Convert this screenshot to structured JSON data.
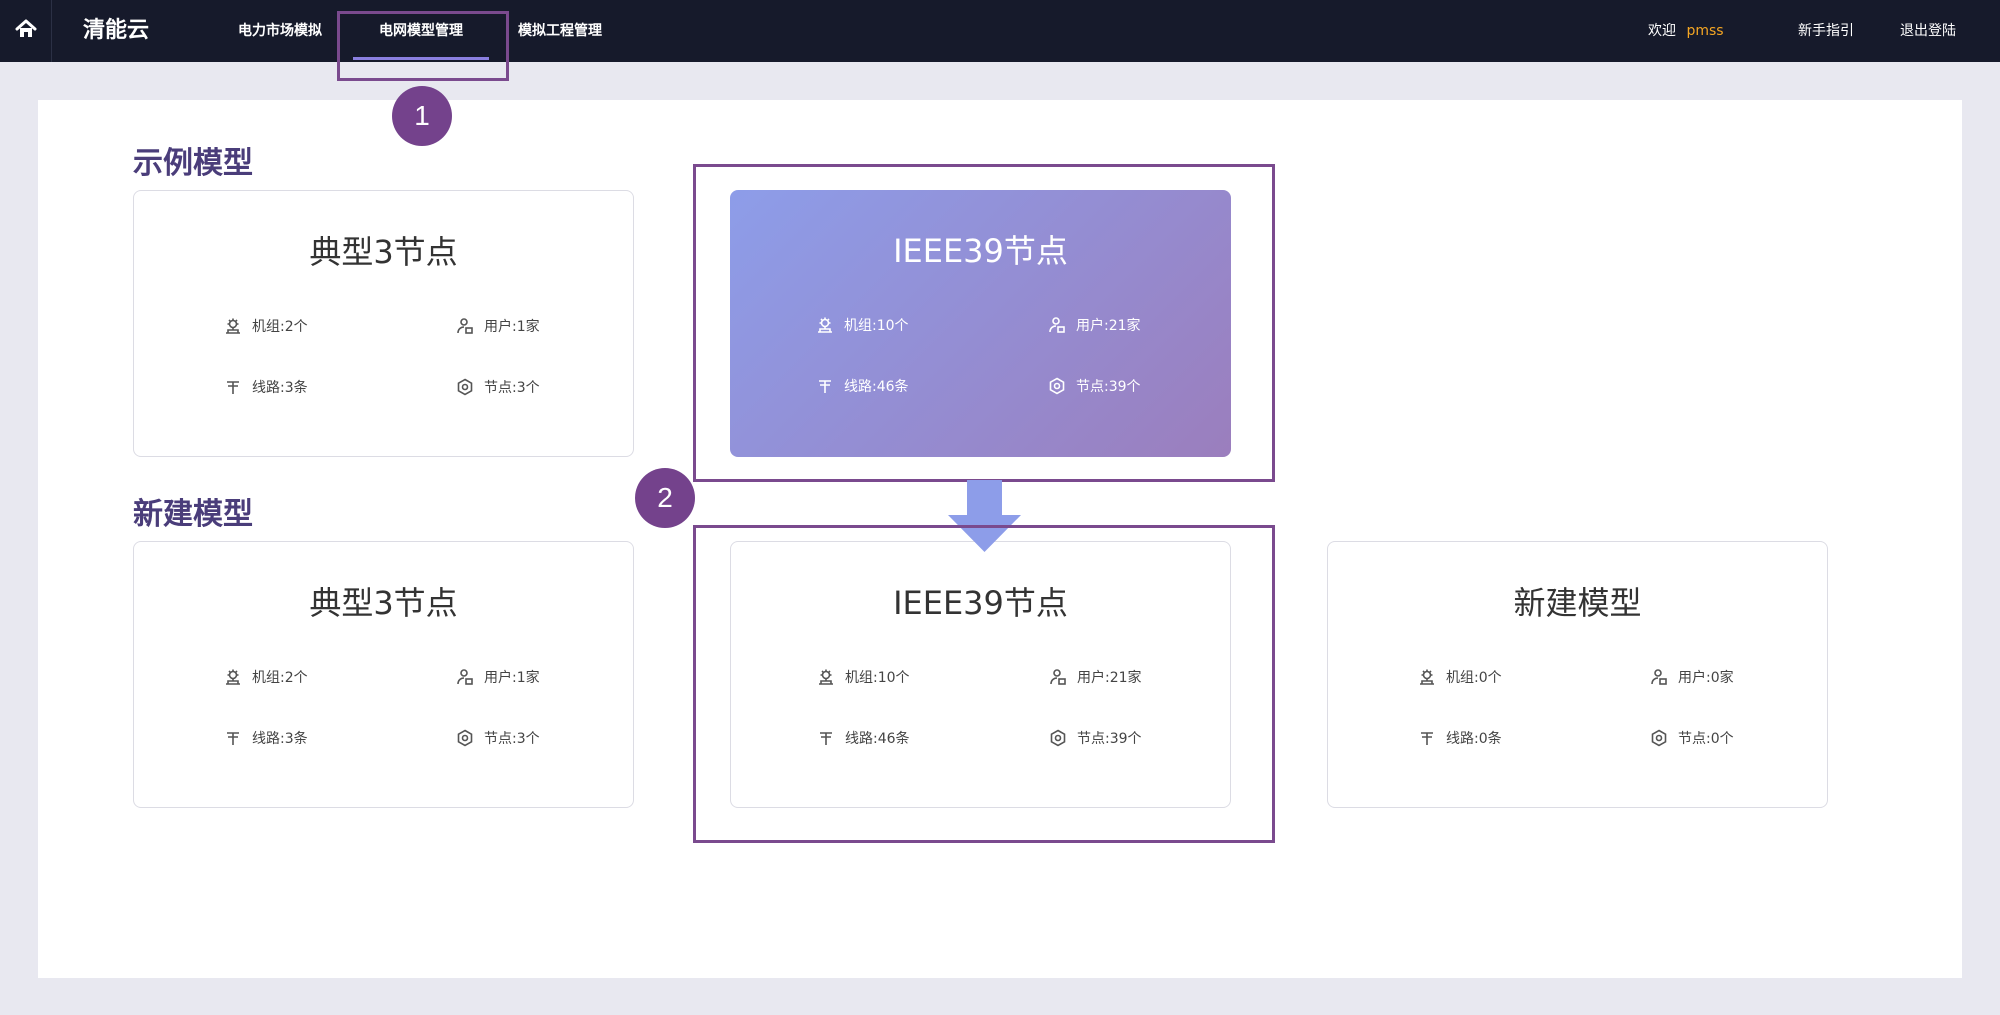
{
  "header": {
    "home_icon": "home-icon",
    "brand": "清能云",
    "nav": [
      {
        "label": "电力市场模拟"
      },
      {
        "label": "电网模型管理"
      },
      {
        "label": "模拟工程管理"
      }
    ],
    "welcome_label": "欢迎",
    "username": "pmss",
    "guide_label": "新手指引",
    "logout_label": "退出登陆"
  },
  "sections": {
    "examples_title": "示例模型",
    "new_title": "新建模型"
  },
  "example_cards": [
    {
      "title": "典型3节点",
      "units": "机组:2个",
      "users": "用户:1家",
      "lines": "线路:3条",
      "nodes": "节点:3个"
    },
    {
      "title": "IEEE39节点",
      "units": "机组:10个",
      "users": "用户:21家",
      "lines": "线路:46条",
      "nodes": "节点:39个"
    }
  ],
  "new_cards": [
    {
      "title": "典型3节点",
      "units": "机组:2个",
      "users": "用户:1家",
      "lines": "线路:3条",
      "nodes": "节点:3个"
    },
    {
      "title": "IEEE39节点",
      "units": "机组:10个",
      "users": "用户:21家",
      "lines": "线路:46条",
      "nodes": "节点:39个"
    },
    {
      "title": "新建模型",
      "units": "机组:0个",
      "users": "用户:0家",
      "lines": "线路:0条",
      "nodes": "节点:0个"
    }
  ],
  "annotations": {
    "step1": "1",
    "step2": "2",
    "highlight_color": "#7a4a8e",
    "arrow_color": "#8d9de9"
  },
  "colors": {
    "topbar": "#161a2b",
    "accent": "#8a7fe0",
    "username": "#f5a623",
    "section_title": "#4a3d7a"
  }
}
